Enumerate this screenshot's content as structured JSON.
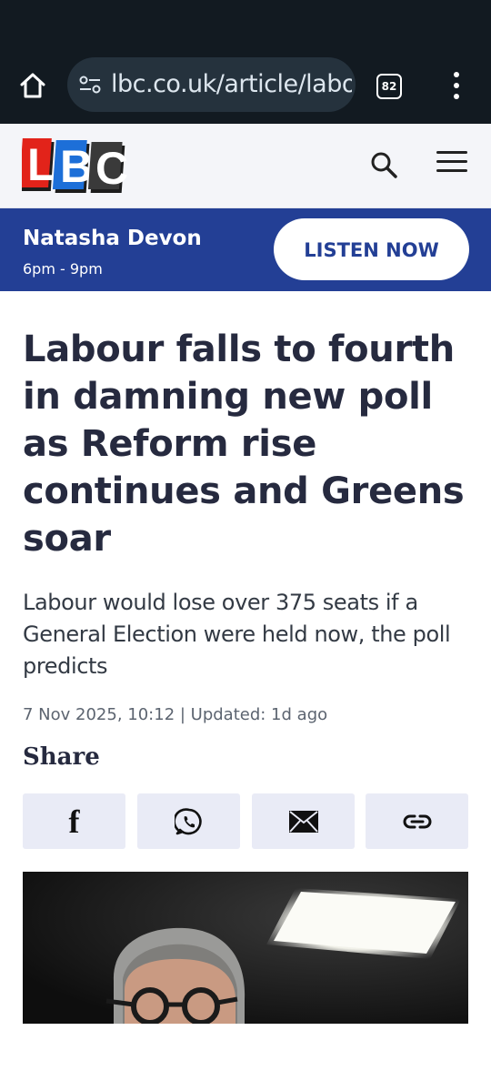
{
  "browser": {
    "url": "lbc.co.uk/article/labour-falls-to-fourth",
    "tab_count": "82"
  },
  "site": {
    "brand": "LBC"
  },
  "onair": {
    "presenter": "Natasha Devon",
    "time": "6pm - 9pm",
    "listen_label": "LISTEN NOW"
  },
  "article": {
    "headline": "Labour falls to fourth in damning new poll as Reform rise continues and Greens soar",
    "standfirst": "Labour would lose over 375 seats if a General Election were held now, the poll predicts",
    "dateline": "7 Nov 2025, 10:12 | Updated: 1d ago",
    "share_label": "Share"
  },
  "share": {
    "facebook_icon": "f"
  },
  "colors": {
    "browser_bg": "#121a21",
    "onair_bg": "#233f95",
    "headline": "#262a3f",
    "share_bg": "#e9ebf6"
  }
}
